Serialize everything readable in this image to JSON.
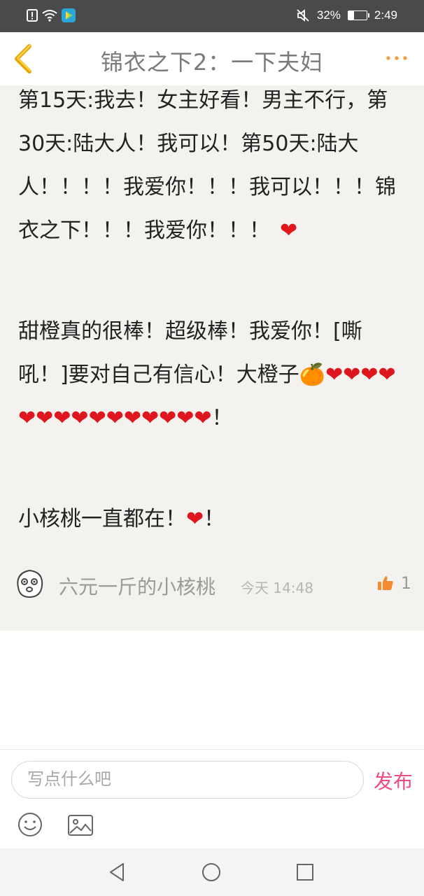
{
  "status_bar": {
    "battery": "32%",
    "battery_level": 0.32,
    "time": "2:49",
    "icons": [
      "notification-icon",
      "wifi-icon",
      "play-store-icon",
      "mute-icon",
      "battery-icon"
    ]
  },
  "nav": {
    "title": "锦衣之下2：一下夫妇",
    "back_icon": "chevron-left-icon",
    "more_icon": "more-dots-icon",
    "accent_color": "#f2a200",
    "more_color": "#f59a3c"
  },
  "post": {
    "p1": "第15天:我去！女主好看！男主不行，第30天:陆大人！我可以！第50天:陆大人！！！！我爱你！！！我可以！！！锦衣之下！！！我爱你！！！",
    "p2": "甜橙真的很棒！超级棒！我爱你！[嘶吼！]要对自己有信心！大橙子",
    "p3": "小核桃一直都在！",
    "exclaim": "！",
    "heart": "❤",
    "orange": "🍊",
    "hearts_p2_count": 15
  },
  "author": {
    "name": "六元一斤的小核桃",
    "time": "今天 14:48",
    "likes": "1",
    "like_icon": "thumbs-up-icon",
    "avatar_icon": "avatar-icon"
  },
  "composer": {
    "placeholder": "写点什么吧",
    "publish_label": "发布",
    "publish_color": "#ec4b86",
    "emoji_icon": "emoji-icon",
    "image_icon": "image-icon"
  },
  "system_nav": {
    "icons": [
      "triangle-back-icon",
      "circle-home-icon",
      "square-recents-icon"
    ]
  }
}
